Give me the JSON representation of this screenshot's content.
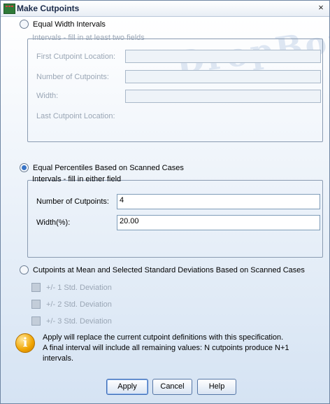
{
  "window": {
    "title": "Make Cutpoints",
    "close_glyph": "×"
  },
  "watermark": "DropBox",
  "equal_width": {
    "radio_label": "Equal Width Intervals",
    "group_title": "Intervals - fill in at least two fields",
    "first_cutpoint_label": "First Cutpoint Location:",
    "first_cutpoint_value": "",
    "number_of_cutpoints_label": "Number of Cutpoints:",
    "number_of_cutpoints_value": "",
    "width_label": "Width:",
    "width_value": "",
    "last_cutpoint_label": "Last Cutpoint Location:"
  },
  "equal_percentiles": {
    "radio_label": "Equal Percentiles Based on Scanned Cases",
    "selected": true,
    "group_title": "Intervals - fill in either field",
    "number_of_cutpoints_label": "Number of Cutpoints:",
    "number_of_cutpoints_value": "4",
    "width_label": "Width(%):",
    "width_value": "20.00"
  },
  "mean_sd": {
    "radio_label": "Cutpoints at Mean and Selected Standard Deviations Based on Scanned Cases",
    "options": [
      {
        "label": "+/- 1 Std. Deviation"
      },
      {
        "label": "+/- 2 Std. Deviation"
      },
      {
        "label": "+/- 3 Std. Deviation"
      }
    ]
  },
  "info": {
    "icon": "info-icon",
    "line1": "Apply will replace the current cutpoint definitions with this specification.",
    "line2": "A final interval will include all remaining values: N cutpoints produce N+1",
    "line3": "intervals."
  },
  "buttons": {
    "apply": "Apply",
    "cancel": "Cancel",
    "help": "Help"
  }
}
